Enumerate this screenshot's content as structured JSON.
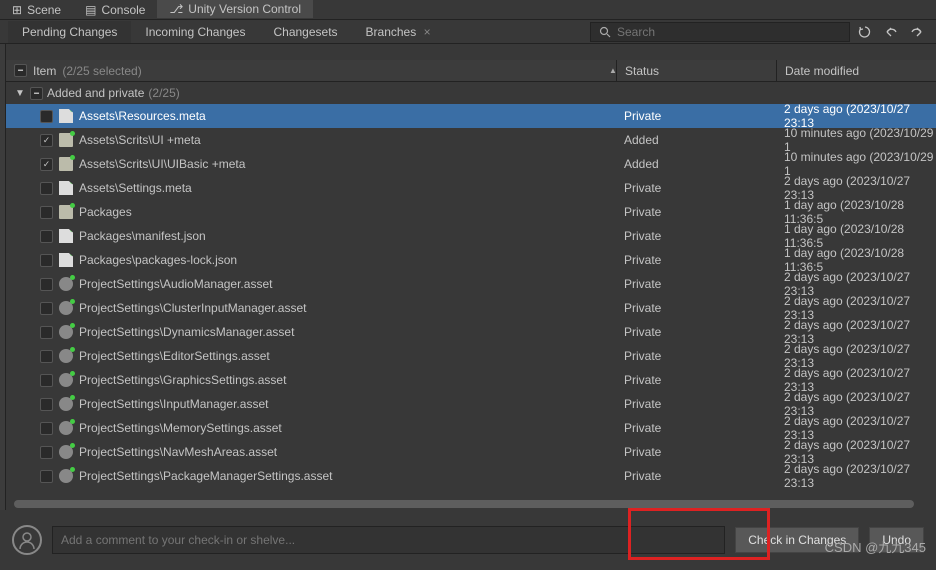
{
  "tabs": {
    "scene": "Scene",
    "console": "Console",
    "uvc": "Unity Version Control"
  },
  "toolbar_tabs": {
    "pending": "Pending Changes",
    "incoming": "Incoming Changes",
    "changesets": "Changesets",
    "branches": "Branches"
  },
  "search": {
    "placeholder": "Search"
  },
  "columns": {
    "item": "Item",
    "item_count": "(2/25 selected)",
    "status": "Status",
    "date": "Date modified"
  },
  "group": {
    "label": "Added and private",
    "count": "(2/25)"
  },
  "rows": [
    {
      "checked": false,
      "icon": "file",
      "selected": true,
      "name": "Assets\\Resources.meta",
      "status": "Private",
      "date": "2 days ago (2023/10/27 23:13"
    },
    {
      "checked": true,
      "icon": "folder",
      "selected": false,
      "name": "Assets\\Scrits\\UI +meta",
      "status": "Added",
      "date": "10 minutes ago (2023/10/29 1"
    },
    {
      "checked": true,
      "icon": "folder",
      "selected": false,
      "name": "Assets\\Scrits\\UI\\UIBasic +meta",
      "status": "Added",
      "date": "10 minutes ago (2023/10/29 1"
    },
    {
      "checked": false,
      "icon": "file",
      "selected": false,
      "name": "Assets\\Settings.meta",
      "status": "Private",
      "date": "2 days ago (2023/10/27 23:13"
    },
    {
      "checked": false,
      "icon": "folder",
      "selected": false,
      "name": "Packages",
      "status": "Private",
      "date": "1 day ago (2023/10/28 11:36:5"
    },
    {
      "checked": false,
      "icon": "file",
      "selected": false,
      "name": "Packages\\manifest.json",
      "status": "Private",
      "date": "1 day ago (2023/10/28 11:36:5"
    },
    {
      "checked": false,
      "icon": "file",
      "selected": false,
      "name": "Packages\\packages-lock.json",
      "status": "Private",
      "date": "1 day ago (2023/10/28 11:36:5"
    },
    {
      "checked": false,
      "icon": "gear",
      "selected": false,
      "name": "ProjectSettings\\AudioManager.asset",
      "status": "Private",
      "date": "2 days ago (2023/10/27 23:13"
    },
    {
      "checked": false,
      "icon": "gear",
      "selected": false,
      "name": "ProjectSettings\\ClusterInputManager.asset",
      "status": "Private",
      "date": "2 days ago (2023/10/27 23:13"
    },
    {
      "checked": false,
      "icon": "gear",
      "selected": false,
      "name": "ProjectSettings\\DynamicsManager.asset",
      "status": "Private",
      "date": "2 days ago (2023/10/27 23:13"
    },
    {
      "checked": false,
      "icon": "gear",
      "selected": false,
      "name": "ProjectSettings\\EditorSettings.asset",
      "status": "Private",
      "date": "2 days ago (2023/10/27 23:13"
    },
    {
      "checked": false,
      "icon": "gear",
      "selected": false,
      "name": "ProjectSettings\\GraphicsSettings.asset",
      "status": "Private",
      "date": "2 days ago (2023/10/27 23:13"
    },
    {
      "checked": false,
      "icon": "gear",
      "selected": false,
      "name": "ProjectSettings\\InputManager.asset",
      "status": "Private",
      "date": "2 days ago (2023/10/27 23:13"
    },
    {
      "checked": false,
      "icon": "gear",
      "selected": false,
      "name": "ProjectSettings\\MemorySettings.asset",
      "status": "Private",
      "date": "2 days ago (2023/10/27 23:13"
    },
    {
      "checked": false,
      "icon": "gear",
      "selected": false,
      "name": "ProjectSettings\\NavMeshAreas.asset",
      "status": "Private",
      "date": "2 days ago (2023/10/27 23:13"
    },
    {
      "checked": false,
      "icon": "gear",
      "selected": false,
      "name": "ProjectSettings\\PackageManagerSettings.asset",
      "status": "Private",
      "date": "2 days ago (2023/10/27 23:13"
    }
  ],
  "comment_placeholder": "Add a comment to your check-in or shelve...",
  "buttons": {
    "checkin": "Check in Changes",
    "undo": "Undo"
  },
  "watermark": "CSDN @九九345"
}
